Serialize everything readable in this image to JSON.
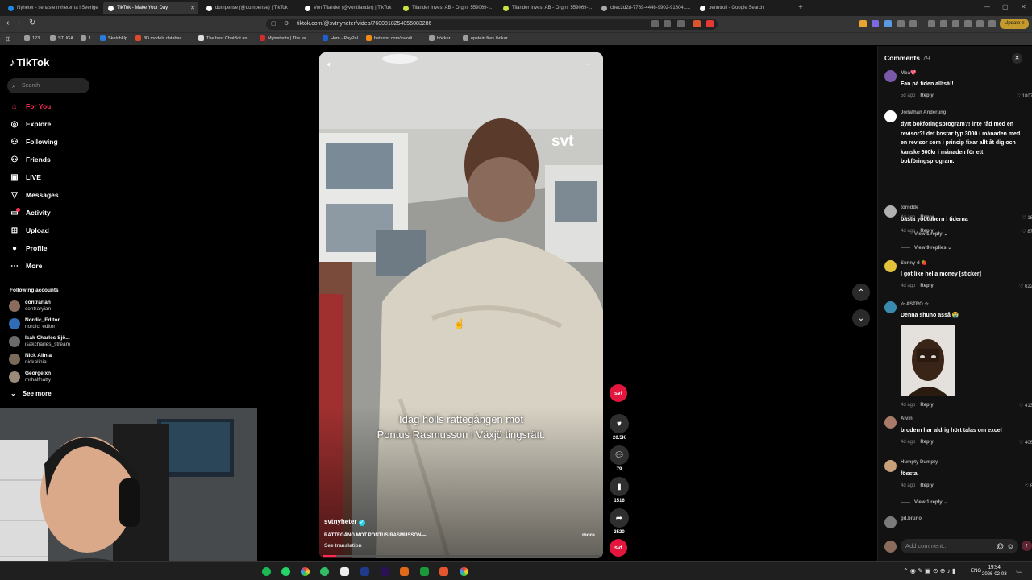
{
  "browser": {
    "tabs": [
      {
        "label": "Nyheter - senaste nyheterna i Sverige",
        "color": "#1e88e5"
      },
      {
        "label": "TikTok - Make Your Day",
        "color": "#ffffff",
        "active": true
      },
      {
        "label": "dumpense (@dumpense) | TikTok",
        "color": "#ffffff"
      },
      {
        "label": "Von Tilander (@vontilander) | TikTok",
        "color": "#ffffff"
      },
      {
        "label": "Tilander Invest AB - Org.nr 559069-...",
        "color": "#c8e63c"
      },
      {
        "label": "Tilander Invest AB - Org.nr 559069-...",
        "color": "#c8e63c"
      },
      {
        "label": "cbec2d2d-7789-4446-9902-918041...",
        "color": "#aaaaaa"
      },
      {
        "label": "penntroll - Google Search",
        "color": "#ffffff"
      }
    ],
    "new_tab": "+",
    "url": "tiktok.com/@svtnyheter/video/7600818254055083286",
    "update_label": "Update",
    "bookmarks": [
      {
        "label": "123",
        "color": "#9e9e9e"
      },
      {
        "label": "STUGA",
        "color": "#9e9e9e"
      },
      {
        "label": "1",
        "color": "#9e9e9e"
      },
      {
        "label": "SketchUp",
        "color": "#2a7be0"
      },
      {
        "label": "3D models databas...",
        "color": "#e04a2a"
      },
      {
        "label": "The best ChatBot an...",
        "color": "#dddddd"
      },
      {
        "label": "Myinstants | The lar...",
        "color": "#d42b2b"
      },
      {
        "label": "Hem - PayPal",
        "color": "#1f5fd6"
      },
      {
        "label": "betsson.com/sv/odi...",
        "color": "#f28b16"
      },
      {
        "label": "böcker",
        "color": "#9e9e9e"
      },
      {
        "label": "epstein files länkar",
        "color": "#9e9e9e"
      }
    ]
  },
  "tiktok": {
    "logo": "TikTok",
    "search_placeholder": "Search",
    "nav": [
      {
        "label": "For You",
        "icon": "home-icon",
        "glyph": "⌂",
        "active": true
      },
      {
        "label": "Explore",
        "icon": "compass-icon",
        "glyph": "◎"
      },
      {
        "label": "Following",
        "icon": "following-icon",
        "glyph": "⚇"
      },
      {
        "label": "Friends",
        "icon": "friends-icon",
        "glyph": "⚇"
      },
      {
        "label": "LIVE",
        "icon": "live-icon",
        "glyph": "▣"
      },
      {
        "label": "Messages",
        "icon": "messages-icon",
        "glyph": "▽"
      },
      {
        "label": "Activity",
        "icon": "activity-icon",
        "glyph": "▭"
      },
      {
        "label": "Upload",
        "icon": "upload-icon",
        "glyph": "⊞"
      },
      {
        "label": "Profile",
        "icon": "profile-icon",
        "glyph": "●"
      },
      {
        "label": "More",
        "icon": "more-icon",
        "glyph": "⋯"
      }
    ],
    "following_title": "Following accounts",
    "following": [
      {
        "name": "contrarian",
        "user": "contraryian",
        "color": "#8a6b5c"
      },
      {
        "name": "Nordic_Editor",
        "user": "nordic_editor",
        "color": "#2f6cb3"
      },
      {
        "name": "Isak Charles Sjö...",
        "user": "isakcharles_stream",
        "color": "#6a6a6a"
      },
      {
        "name": "Nick Alinia",
        "user": "nickalinia",
        "color": "#7a6a5a"
      },
      {
        "name": "Georgeixn",
        "user": "mrhalfnatty",
        "color": "#9a8a7a"
      }
    ],
    "see_more": "See more"
  },
  "video": {
    "caption_line1": "Idag hölls rättegången mot",
    "caption_line2": "Pontus Rasmusson i Växjö tingsrätt.",
    "watermark": "svt",
    "author": "svtnyheter",
    "description": "RÄTTEGÅNG MOT PONTUS RASMUSSON—",
    "more": "more",
    "see_translation": "See translation",
    "progress": 0.05
  },
  "actions": {
    "avatar_label": "svt",
    "likes": "20.5K",
    "comments": "79",
    "saves": "1516",
    "shares": "3520"
  },
  "comments_panel": {
    "title": "Comments",
    "count": "79",
    "close": "✕",
    "add_placeholder": "Add comment...",
    "reply_label": "Reply",
    "comments": [
      {
        "user": "Moa💖",
        "text": "Fan på tiden alltså!!",
        "time": "5d ago",
        "likes": "1807",
        "color": "#7a5aa8"
      },
      {
        "user": "Jonathan Anderung",
        "text": "dyrt bokföringsprogram?! inte råd med en revisor?! det kostar typ 3000 i månaden med en revisor som i princip fixar allt åt dig och kanske 600kr i månaden för ett bokföringsprogram.",
        "time": "4d ago",
        "likes": "16",
        "color": "#ffffff",
        "view": "View 1 reply"
      },
      {
        "user": "torndde",
        "text": "bästa youtubern i tiderna",
        "time": "4d ago",
        "likes": "87",
        "color": "#b0b0b0",
        "view": "View 9 replies"
      },
      {
        "user": "Sunny d 🍓",
        "text": "I got like hella money [sticker]",
        "time": "4d ago",
        "likes": "622",
        "color": "#e2c23a"
      },
      {
        "user": "☆ ASTRO ☆",
        "text": "Denna shuno asså 😭",
        "time": "4d ago",
        "likes": "413",
        "color": "#3a8ab0"
      },
      {
        "user": "Alvin",
        "text": "brodern har aldrig hört talas om excel",
        "time": "4d ago",
        "likes": "406",
        "color": "#a87a6a"
      },
      {
        "user": "Humpty Dumpty",
        "text": "fössta.",
        "time": "4d ago",
        "likes": "8",
        "color": "#c8a07a",
        "view": "View 1 reply"
      },
      {
        "user": "gd.bruno",
        "text": "",
        "color": "#7a7a7a"
      }
    ]
  },
  "taskbar": {
    "time": "19:54",
    "date": "2026-02-03",
    "lang": "ENG"
  }
}
